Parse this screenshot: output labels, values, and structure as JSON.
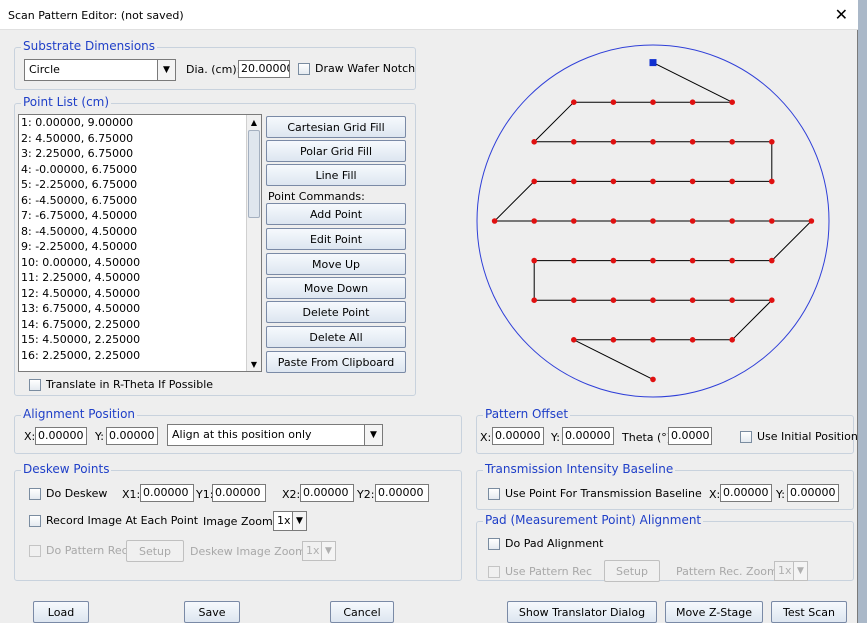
{
  "window": {
    "title": "Scan Pattern Editor: (not saved)",
    "close_glyph": "✕"
  },
  "substrate": {
    "legend": "Substrate Dimensions",
    "shape": "Circle",
    "dia_label": "Dia. (cm):",
    "dia_value": "20.00000",
    "notch_label": "Draw Wafer Notch",
    "notch_checked": false
  },
  "point_list": {
    "legend": "Point List (cm)",
    "items": [
      "1:  0.00000, 9.00000",
      "2:  4.50000, 6.75000",
      "3:  2.25000, 6.75000",
      "4:  -0.00000, 6.75000",
      "5:  -2.25000, 6.75000",
      "6:  -4.50000, 6.75000",
      "7:  -6.75000, 4.50000",
      "8:  -4.50000, 4.50000",
      "9:  -2.25000, 4.50000",
      "10:  0.00000, 4.50000",
      "11:  2.25000, 4.50000",
      "12:  4.50000, 4.50000",
      "13:  6.75000, 4.50000",
      "14:  6.75000, 2.25000",
      "15:  4.50000, 2.25000",
      "16:  2.25000, 2.25000"
    ],
    "fill_buttons": [
      "Cartesian Grid Fill",
      "Polar Grid Fill",
      "Line Fill"
    ],
    "commands_label": "Point Commands:",
    "command_buttons": [
      "Add Point",
      "Edit Point",
      "Move Up",
      "Move Down",
      "Delete Point",
      "Delete All",
      "Paste From Clipboard"
    ],
    "translate_label": "Translate in R-Theta If Possible"
  },
  "alignment": {
    "legend": "Alignment Position",
    "x_label": "X:",
    "x_value": "0.00000",
    "y_label": "Y:",
    "y_value": "0.00000",
    "mode": "Align at this position only"
  },
  "deskew": {
    "legend": "Deskew Points",
    "do_deskew": "Do Deskew",
    "x1_label": "X1:",
    "x1_value": "0.00000",
    "y1_label": "Y1:",
    "y1_value": "0.00000",
    "x2_label": "X2:",
    "x2_value": "0.00000",
    "y2_label": "Y2:",
    "y2_value": "0.00000",
    "record_label": "Record Image At Each Point",
    "image_zoom_label": "Image Zoom:",
    "image_zoom_value": "1x",
    "pattern_rec_label": "Do Pattern Rec",
    "setup_label": "Setup",
    "deskew_zoom_label": "Deskew Image Zoom:",
    "deskew_zoom_value": "1x"
  },
  "pattern_offset": {
    "legend": "Pattern Offset",
    "x_label": "X:",
    "x_value": "0.00000",
    "y_label": "Y:",
    "y_value": "0.00000",
    "theta_label": "Theta (°):",
    "theta_value": "0.0000",
    "use_initial_label": "Use Initial Position"
  },
  "transmission": {
    "legend": "Transmission Intensity Baseline",
    "use_point_label": "Use Point For Transmission Baseline",
    "x_label": "X:",
    "x_value": "0.00000",
    "y_label": "Y:",
    "y_value": "0.00000"
  },
  "pad": {
    "legend": "Pad (Measurement Point) Alignment",
    "do_pad_label": "Do Pad Alignment",
    "use_pattern_label": "Use Pattern Rec",
    "setup_label": "Setup",
    "zoom_label": "Pattern Rec. Zoom:",
    "zoom_value": "1x"
  },
  "footer": {
    "load": "Load",
    "save": "Save",
    "cancel": "Cancel",
    "show_translator": "Show Translator Dialog",
    "move_z": "Move Z-Stage",
    "test_scan": "Test Scan"
  },
  "preview": {
    "wafer_color": "#2f3fd8",
    "point_color": "#e01010",
    "start_point_color": "#1030d0",
    "path_color": "#000000",
    "wafer_radius_cm": 10,
    "points": [
      [
        0.0,
        9.0
      ],
      [
        4.5,
        6.75
      ],
      [
        2.25,
        6.75
      ],
      [
        0.0,
        6.75
      ],
      [
        -2.25,
        6.75
      ],
      [
        -4.5,
        6.75
      ],
      [
        -6.75,
        4.5
      ],
      [
        -4.5,
        4.5
      ],
      [
        -2.25,
        4.5
      ],
      [
        0.0,
        4.5
      ],
      [
        2.25,
        4.5
      ],
      [
        4.5,
        4.5
      ],
      [
        6.75,
        4.5
      ],
      [
        6.75,
        2.25
      ],
      [
        4.5,
        2.25
      ],
      [
        2.25,
        2.25
      ],
      [
        0.0,
        2.25
      ],
      [
        -2.25,
        2.25
      ],
      [
        -4.5,
        2.25
      ],
      [
        -6.75,
        2.25
      ],
      [
        -9.0,
        0.0
      ],
      [
        -6.75,
        0.0
      ],
      [
        -4.5,
        0.0
      ],
      [
        -2.25,
        0.0
      ],
      [
        0.0,
        0.0
      ],
      [
        2.25,
        0.0
      ],
      [
        4.5,
        0.0
      ],
      [
        6.75,
        0.0
      ],
      [
        9.0,
        0.0
      ],
      [
        6.75,
        -2.25
      ],
      [
        4.5,
        -2.25
      ],
      [
        2.25,
        -2.25
      ],
      [
        0.0,
        -2.25
      ],
      [
        -2.25,
        -2.25
      ],
      [
        -4.5,
        -2.25
      ],
      [
        -6.75,
        -2.25
      ],
      [
        -6.75,
        -4.5
      ],
      [
        -4.5,
        -4.5
      ],
      [
        -2.25,
        -4.5
      ],
      [
        0.0,
        -4.5
      ],
      [
        2.25,
        -4.5
      ],
      [
        4.5,
        -4.5
      ],
      [
        6.75,
        -4.5
      ],
      [
        4.5,
        -6.75
      ],
      [
        2.25,
        -6.75
      ],
      [
        0.0,
        -6.75
      ],
      [
        -2.25,
        -6.75
      ],
      [
        -4.5,
        -6.75
      ],
      [
        0.0,
        -9.0
      ]
    ]
  }
}
